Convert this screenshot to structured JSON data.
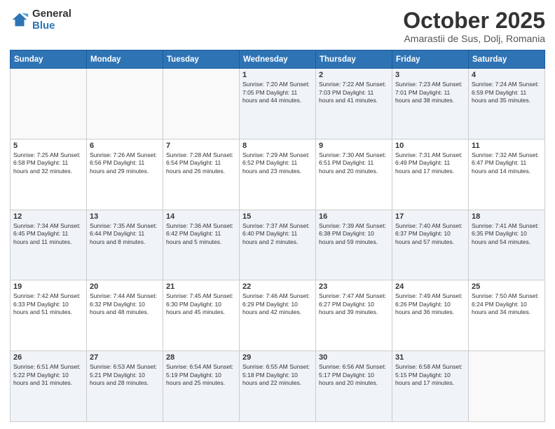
{
  "header": {
    "logo_general": "General",
    "logo_blue": "Blue",
    "month_title": "October 2025",
    "location": "Amarastii de Sus, Dolj, Romania"
  },
  "days_of_week": [
    "Sunday",
    "Monday",
    "Tuesday",
    "Wednesday",
    "Thursday",
    "Friday",
    "Saturday"
  ],
  "weeks": [
    [
      {
        "day": "",
        "content": "",
        "empty": true
      },
      {
        "day": "",
        "content": "",
        "empty": true
      },
      {
        "day": "",
        "content": "",
        "empty": true
      },
      {
        "day": "1",
        "content": "Sunrise: 7:20 AM\nSunset: 7:05 PM\nDaylight: 11 hours and 44 minutes.",
        "empty": false
      },
      {
        "day": "2",
        "content": "Sunrise: 7:22 AM\nSunset: 7:03 PM\nDaylight: 11 hours and 41 minutes.",
        "empty": false
      },
      {
        "day": "3",
        "content": "Sunrise: 7:23 AM\nSunset: 7:01 PM\nDaylight: 11 hours and 38 minutes.",
        "empty": false
      },
      {
        "day": "4",
        "content": "Sunrise: 7:24 AM\nSunset: 6:59 PM\nDaylight: 11 hours and 35 minutes.",
        "empty": false
      }
    ],
    [
      {
        "day": "5",
        "content": "Sunrise: 7:25 AM\nSunset: 6:58 PM\nDaylight: 11 hours and 32 minutes.",
        "empty": false
      },
      {
        "day": "6",
        "content": "Sunrise: 7:26 AM\nSunset: 6:56 PM\nDaylight: 11 hours and 29 minutes.",
        "empty": false
      },
      {
        "day": "7",
        "content": "Sunrise: 7:28 AM\nSunset: 6:54 PM\nDaylight: 11 hours and 26 minutes.",
        "empty": false
      },
      {
        "day": "8",
        "content": "Sunrise: 7:29 AM\nSunset: 6:52 PM\nDaylight: 11 hours and 23 minutes.",
        "empty": false
      },
      {
        "day": "9",
        "content": "Sunrise: 7:30 AM\nSunset: 6:51 PM\nDaylight: 11 hours and 20 minutes.",
        "empty": false
      },
      {
        "day": "10",
        "content": "Sunrise: 7:31 AM\nSunset: 6:49 PM\nDaylight: 11 hours and 17 minutes.",
        "empty": false
      },
      {
        "day": "11",
        "content": "Sunrise: 7:32 AM\nSunset: 6:47 PM\nDaylight: 11 hours and 14 minutes.",
        "empty": false
      }
    ],
    [
      {
        "day": "12",
        "content": "Sunrise: 7:34 AM\nSunset: 6:45 PM\nDaylight: 11 hours and 11 minutes.",
        "empty": false
      },
      {
        "day": "13",
        "content": "Sunrise: 7:35 AM\nSunset: 6:44 PM\nDaylight: 11 hours and 8 minutes.",
        "empty": false
      },
      {
        "day": "14",
        "content": "Sunrise: 7:36 AM\nSunset: 6:42 PM\nDaylight: 11 hours and 5 minutes.",
        "empty": false
      },
      {
        "day": "15",
        "content": "Sunrise: 7:37 AM\nSunset: 6:40 PM\nDaylight: 11 hours and 2 minutes.",
        "empty": false
      },
      {
        "day": "16",
        "content": "Sunrise: 7:39 AM\nSunset: 6:38 PM\nDaylight: 10 hours and 59 minutes.",
        "empty": false
      },
      {
        "day": "17",
        "content": "Sunrise: 7:40 AM\nSunset: 6:37 PM\nDaylight: 10 hours and 57 minutes.",
        "empty": false
      },
      {
        "day": "18",
        "content": "Sunrise: 7:41 AM\nSunset: 6:35 PM\nDaylight: 10 hours and 54 minutes.",
        "empty": false
      }
    ],
    [
      {
        "day": "19",
        "content": "Sunrise: 7:42 AM\nSunset: 6:33 PM\nDaylight: 10 hours and 51 minutes.",
        "empty": false
      },
      {
        "day": "20",
        "content": "Sunrise: 7:44 AM\nSunset: 6:32 PM\nDaylight: 10 hours and 48 minutes.",
        "empty": false
      },
      {
        "day": "21",
        "content": "Sunrise: 7:45 AM\nSunset: 6:30 PM\nDaylight: 10 hours and 45 minutes.",
        "empty": false
      },
      {
        "day": "22",
        "content": "Sunrise: 7:46 AM\nSunset: 6:29 PM\nDaylight: 10 hours and 42 minutes.",
        "empty": false
      },
      {
        "day": "23",
        "content": "Sunrise: 7:47 AM\nSunset: 6:27 PM\nDaylight: 10 hours and 39 minutes.",
        "empty": false
      },
      {
        "day": "24",
        "content": "Sunrise: 7:49 AM\nSunset: 6:26 PM\nDaylight: 10 hours and 36 minutes.",
        "empty": false
      },
      {
        "day": "25",
        "content": "Sunrise: 7:50 AM\nSunset: 6:24 PM\nDaylight: 10 hours and 34 minutes.",
        "empty": false
      }
    ],
    [
      {
        "day": "26",
        "content": "Sunrise: 6:51 AM\nSunset: 5:22 PM\nDaylight: 10 hours and 31 minutes.",
        "empty": false
      },
      {
        "day": "27",
        "content": "Sunrise: 6:53 AM\nSunset: 5:21 PM\nDaylight: 10 hours and 28 minutes.",
        "empty": false
      },
      {
        "day": "28",
        "content": "Sunrise: 6:54 AM\nSunset: 5:19 PM\nDaylight: 10 hours and 25 minutes.",
        "empty": false
      },
      {
        "day": "29",
        "content": "Sunrise: 6:55 AM\nSunset: 5:18 PM\nDaylight: 10 hours and 22 minutes.",
        "empty": false
      },
      {
        "day": "30",
        "content": "Sunrise: 6:56 AM\nSunset: 5:17 PM\nDaylight: 10 hours and 20 minutes.",
        "empty": false
      },
      {
        "day": "31",
        "content": "Sunrise: 6:58 AM\nSunset: 5:15 PM\nDaylight: 10 hours and 17 minutes.",
        "empty": false
      },
      {
        "day": "",
        "content": "",
        "empty": true
      }
    ]
  ]
}
